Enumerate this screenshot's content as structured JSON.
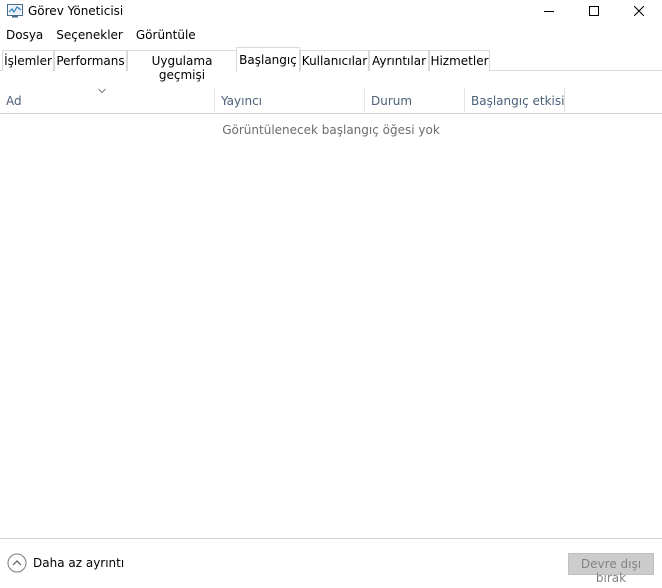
{
  "window": {
    "title": "Görev Yöneticisi"
  },
  "menu": {
    "items": [
      "Dosya",
      "Seçenekler",
      "Görüntüle"
    ]
  },
  "tabs": [
    {
      "label": "İşlemler",
      "active": false
    },
    {
      "label": "Performans",
      "active": false
    },
    {
      "label": "Uygulama geçmişi",
      "active": false
    },
    {
      "label": "Başlangıç",
      "active": true
    },
    {
      "label": "Kullanıcılar",
      "active": false
    },
    {
      "label": "Ayrıntılar",
      "active": false
    },
    {
      "label": "Hizmetler",
      "active": false
    }
  ],
  "table": {
    "columns": [
      "Ad",
      "Yayıncı",
      "Durum",
      "Başlangıç etkisi"
    ],
    "empty_message": "Görüntülenecek başlangıç öğesi yok"
  },
  "footer": {
    "less_details_label": "Daha az ayrıntı",
    "disable_button_label": "Devre dışı bırak"
  }
}
